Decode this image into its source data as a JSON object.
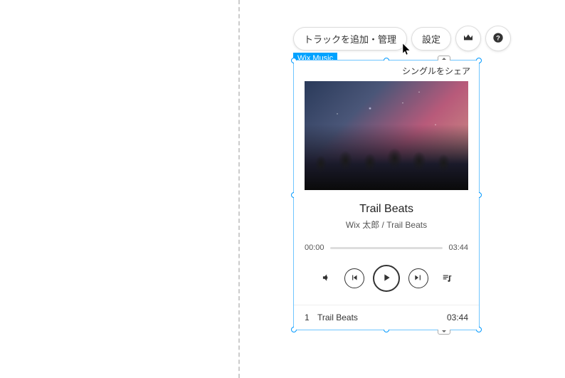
{
  "toolbar": {
    "add_manage_label": "トラックを追加・管理",
    "settings_label": "設定"
  },
  "widget_label": "Wix Music",
  "share_text": "シングルをシェア",
  "player": {
    "title": "Trail Beats",
    "subtitle": "Wix 太郎 / Trail Beats",
    "elapsed": "00:00",
    "duration": "03:44"
  },
  "tracklist": [
    {
      "num": "1",
      "name": "Trail Beats",
      "duration": "03:44"
    }
  ]
}
